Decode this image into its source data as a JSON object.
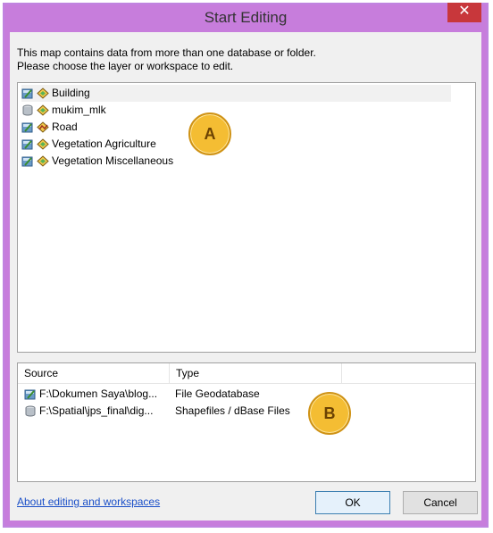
{
  "window": {
    "title": "Start Editing",
    "close_glyph": "✕"
  },
  "message": {
    "line1": "This map contains data from more than one database or folder.",
    "line2": "Please choose the layer or workspace to edit."
  },
  "layers": [
    {
      "name": "Building",
      "workspace_icon": "geodatabase-icon",
      "geometry_icon": "polygon-feature-icon"
    },
    {
      "name": "mukim_mlk",
      "workspace_icon": "shapefile-folder-icon",
      "geometry_icon": "polygon-feature-icon"
    },
    {
      "name": "Road",
      "workspace_icon": "geodatabase-icon",
      "geometry_icon": "line-feature-icon"
    },
    {
      "name": "Vegetation Agriculture",
      "workspace_icon": "geodatabase-icon",
      "geometry_icon": "polygon-feature-icon"
    },
    {
      "name": "Vegetation Miscellaneous",
      "workspace_icon": "geodatabase-icon",
      "geometry_icon": "polygon-feature-icon"
    }
  ],
  "workspaces": {
    "columns": [
      "Source",
      "Type"
    ],
    "rows": [
      {
        "source": "F:\\Dokumen Saya\\blog...",
        "type": "File Geodatabase",
        "icon": "geodatabase-icon"
      },
      {
        "source": "F:\\Spatial\\jps_final\\dig...",
        "type": "Shapefiles / dBase Files",
        "icon": "shapefile-folder-icon"
      }
    ]
  },
  "annotations": {
    "a": "A",
    "b": "B"
  },
  "footer": {
    "about_link": "About editing and workspaces",
    "ok_label": "OK",
    "cancel_label": "Cancel"
  },
  "colors": {
    "title_bar": "#c77ddc",
    "close_button": "#c8373b",
    "link": "#1a4fc8",
    "marker_fill": "#f4bd33"
  }
}
